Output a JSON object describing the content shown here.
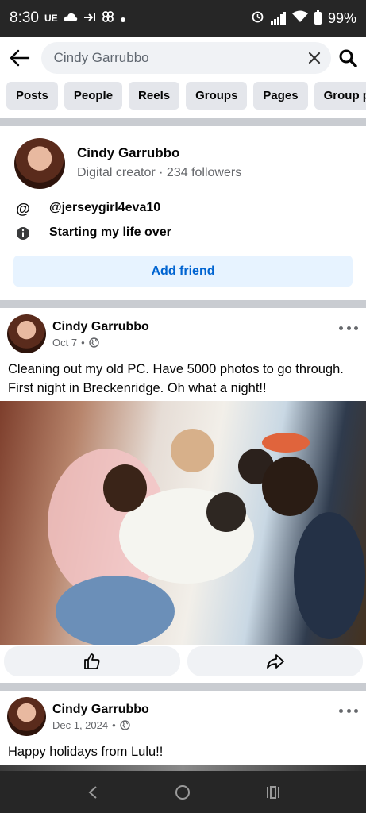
{
  "status_bar": {
    "time": "8:30",
    "carrier": "UE",
    "battery": "99%",
    "icons": [
      "cloud-icon",
      "forward-arrow-icon",
      "pinwheel-icon",
      "dot-icon",
      "alarm-icon",
      "signal-icon",
      "wifi-icon",
      "battery-icon"
    ]
  },
  "search": {
    "query": "Cindy Garrubbo",
    "icons": [
      "back-arrow-icon",
      "clear-icon",
      "search-icon"
    ]
  },
  "filters": [
    "Posts",
    "People",
    "Reels",
    "Groups",
    "Pages",
    "Group pos"
  ],
  "profile": {
    "name": "Cindy Garrubbo",
    "subtitle": "Digital creator · 234 followers",
    "handle": "@jerseygirl4eva10",
    "bio": "Starting my life over",
    "handle_icon": "@",
    "bio_icon": "info-icon",
    "add_friend_label": "Add friend"
  },
  "posts": [
    {
      "author": "Cindy Garrubbo",
      "date": "Oct 7",
      "separator": "•",
      "privacy_icon": "globe-icon",
      "text": "Cleaning out my old PC. Have 5000 photos to go through. First night in Breckenridge. Oh what a night!!",
      "has_photo": true,
      "actions": [
        "like-icon",
        "share-icon"
      ]
    },
    {
      "author": "Cindy Garrubbo",
      "date": "Dec 1, 2024",
      "separator": "•",
      "privacy_icon": "globe-icon",
      "text": "Happy holidays from Lulu!!",
      "has_photo": true
    }
  ],
  "nav_bar": {
    "icons": [
      "nav-back-icon",
      "nav-home-icon",
      "nav-recents-icon"
    ]
  },
  "colors": {
    "status_bg": "#262626",
    "chip_bg": "#e4e6eb",
    "add_friend_bg": "#e7f3ff",
    "add_friend_text": "#0064d1",
    "secondary_text": "#65676b",
    "divider": "#c9ccd1"
  }
}
